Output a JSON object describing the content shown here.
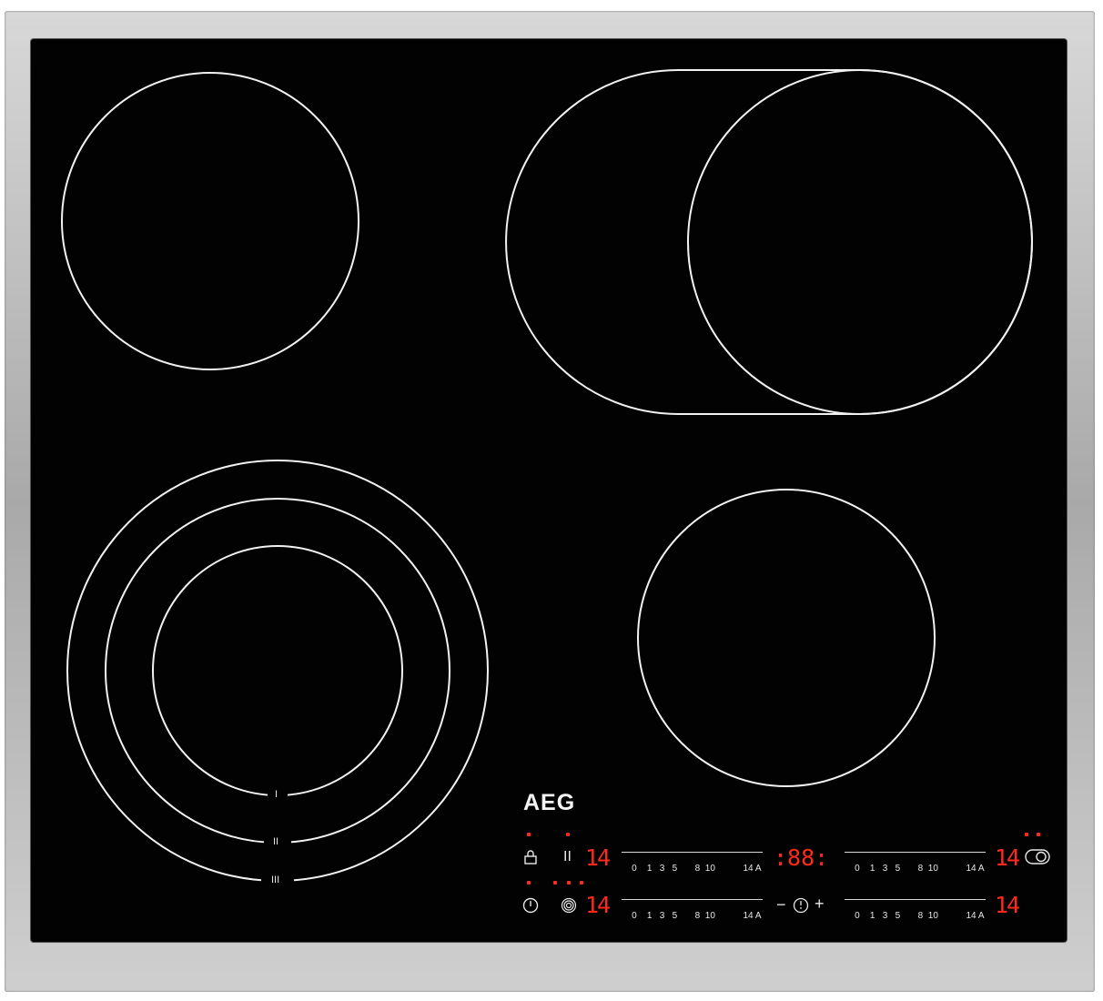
{
  "brand": "AEG",
  "colors": {
    "glass": "#020202",
    "frame": "#b9b9b9",
    "line": "#f2f2f2",
    "display": "#ff2a1e"
  },
  "zones": [
    {
      "name": "rear-left"
    },
    {
      "name": "rear-right-oval"
    },
    {
      "name": "front-left-triple"
    },
    {
      "name": "front-right"
    }
  ],
  "ring_marks": {
    "inner": "I",
    "middle": "II",
    "outer": "III"
  },
  "controls": {
    "row1": {
      "lock_icon": "lock-icon",
      "pause_label": "II",
      "display_left": "14",
      "slider_left": [
        "0",
        "1",
        "3",
        "5",
        "8",
        "10",
        "14",
        "A"
      ],
      "timer_display": ":88:",
      "slider_right": [
        "0",
        "1",
        "3",
        "5",
        "8",
        "10",
        "14",
        "A"
      ],
      "display_right": "14",
      "oval_icon": "oval-zone-icon"
    },
    "row2": {
      "power_icon": "power-icon",
      "rings_icon": "ring-zone-icon",
      "display_left": "14",
      "slider_left": [
        "0",
        "1",
        "3",
        "5",
        "8",
        "10",
        "14",
        "A"
      ],
      "timer_minus": "−",
      "timer_plus": "+",
      "slider_right": [
        "0",
        "1",
        "3",
        "5",
        "8",
        "10",
        "14",
        "A"
      ],
      "display_right": "14"
    }
  }
}
